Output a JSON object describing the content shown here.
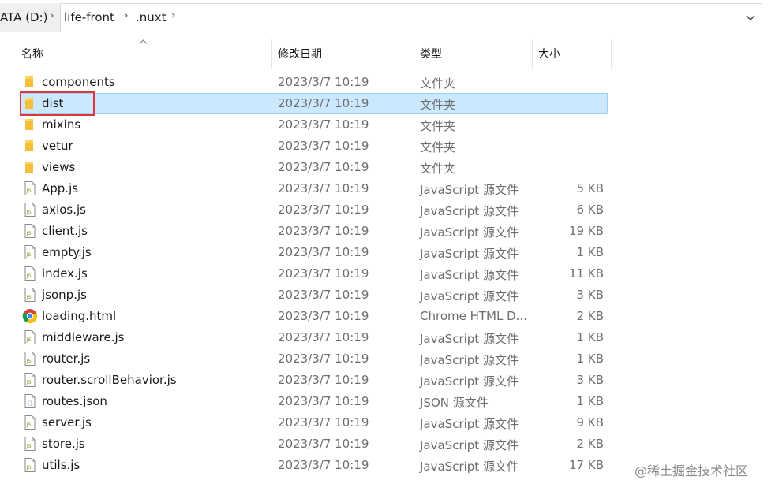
{
  "address": {
    "crumbs": [
      "ATA (D:)",
      "life-front",
      ".nuxt"
    ],
    "separator": "›"
  },
  "columns": {
    "name": "名称",
    "date": "修改日期",
    "type": "类型",
    "size": "大小"
  },
  "rows": [
    {
      "name": "components",
      "date": "2023/3/7 10:19",
      "type": "文件夹",
      "size": "",
      "icon": "folder-icon"
    },
    {
      "name": "dist",
      "date": "2023/3/7 10:19",
      "type": "文件夹",
      "size": "",
      "icon": "folder-icon",
      "selected": true
    },
    {
      "name": "mixins",
      "date": "2023/3/7 10:19",
      "type": "文件夹",
      "size": "",
      "icon": "folder-icon"
    },
    {
      "name": "vetur",
      "date": "2023/3/7 10:19",
      "type": "文件夹",
      "size": "",
      "icon": "folder-icon"
    },
    {
      "name": "views",
      "date": "2023/3/7 10:19",
      "type": "文件夹",
      "size": "",
      "icon": "folder-icon"
    },
    {
      "name": "App.js",
      "date": "2023/3/7 10:19",
      "type": "JavaScript 源文件",
      "size": "5 KB",
      "icon": "js-file-icon"
    },
    {
      "name": "axios.js",
      "date": "2023/3/7 10:19",
      "type": "JavaScript 源文件",
      "size": "6 KB",
      "icon": "js-file-icon"
    },
    {
      "name": "client.js",
      "date": "2023/3/7 10:19",
      "type": "JavaScript 源文件",
      "size": "19 KB",
      "icon": "js-file-icon"
    },
    {
      "name": "empty.js",
      "date": "2023/3/7 10:19",
      "type": "JavaScript 源文件",
      "size": "1 KB",
      "icon": "js-file-icon"
    },
    {
      "name": "index.js",
      "date": "2023/3/7 10:19",
      "type": "JavaScript 源文件",
      "size": "11 KB",
      "icon": "js-file-icon"
    },
    {
      "name": "jsonp.js",
      "date": "2023/3/7 10:19",
      "type": "JavaScript 源文件",
      "size": "3 KB",
      "icon": "js-file-icon"
    },
    {
      "name": "loading.html",
      "date": "2023/3/7 10:19",
      "type": "Chrome HTML D...",
      "size": "2 KB",
      "icon": "chrome-icon"
    },
    {
      "name": "middleware.js",
      "date": "2023/3/7 10:19",
      "type": "JavaScript 源文件",
      "size": "1 KB",
      "icon": "js-file-icon"
    },
    {
      "name": "router.js",
      "date": "2023/3/7 10:19",
      "type": "JavaScript 源文件",
      "size": "1 KB",
      "icon": "js-file-icon"
    },
    {
      "name": "router.scrollBehavior.js",
      "date": "2023/3/7 10:19",
      "type": "JavaScript 源文件",
      "size": "3 KB",
      "icon": "js-file-icon"
    },
    {
      "name": "routes.json",
      "date": "2023/3/7 10:19",
      "type": "JSON 源文件",
      "size": "1 KB",
      "icon": "json-file-icon"
    },
    {
      "name": "server.js",
      "date": "2023/3/7 10:19",
      "type": "JavaScript 源文件",
      "size": "9 KB",
      "icon": "js-file-icon"
    },
    {
      "name": "store.js",
      "date": "2023/3/7 10:19",
      "type": "JavaScript 源文件",
      "size": "2 KB",
      "icon": "js-file-icon"
    },
    {
      "name": "utils.js",
      "date": "2023/3/7 10:19",
      "type": "JavaScript 源文件",
      "size": "17 KB",
      "icon": "js-file-icon"
    }
  ],
  "watermark": "@稀土掘金技术社区",
  "colors": {
    "selection_bg": "#cce8ff",
    "selection_border": "#99d1ff",
    "highlight": "#e0353b",
    "folder": "#f8c94a"
  }
}
